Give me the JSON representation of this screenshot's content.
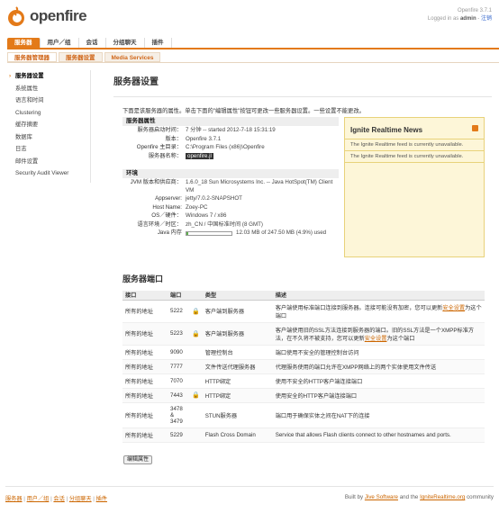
{
  "header": {
    "logo_text": "openfire",
    "version": "Openfire 3.7.1",
    "logged_in_prefix": "Logged in as",
    "user": "admin",
    "logout": "注销"
  },
  "main_tabs": [
    {
      "label": "服务器",
      "active": true
    },
    {
      "label": "用户／组",
      "active": false
    },
    {
      "label": "会话",
      "active": false
    },
    {
      "label": "分组聊天",
      "active": false
    },
    {
      "label": "插件",
      "active": false
    }
  ],
  "sub_tabs": [
    {
      "label": "服务器管理器",
      "active": true
    },
    {
      "label": "服务器设置",
      "active": false
    },
    {
      "label": "Media Services",
      "active": false
    }
  ],
  "sidebar": [
    {
      "label": "服务器设置",
      "active": true
    },
    {
      "label": "系统属性",
      "active": false
    },
    {
      "label": "语言和时间",
      "active": false
    },
    {
      "label": "Clustering",
      "active": false
    },
    {
      "label": "缓存摘要",
      "active": false
    },
    {
      "label": "数据库",
      "active": false
    },
    {
      "label": "日志",
      "active": false
    },
    {
      "label": "邮件设置",
      "active": false
    },
    {
      "label": "Security Audit Viewer",
      "active": false
    }
  ],
  "page": {
    "title": "服务器设置",
    "intro": "下面是该服务器的属性。单击下面的\"编辑属性\"按钮可更改一些服务器设置。一些设置不能更改。"
  },
  "server_props": {
    "header": "服务器属性",
    "rows": [
      {
        "key": "服务器启动时间：",
        "value": "7 分钟 -- started 2012-7-18 15:31:19"
      },
      {
        "key": "版本：",
        "value": "Openfire 3.7.1"
      },
      {
        "key": "Openfire 主目录：",
        "value": "C:\\Program Files (x86)\\Openfire"
      },
      {
        "key": "服务器名称：",
        "value": "openfire.jl"
      }
    ]
  },
  "environment": {
    "header": "环境",
    "rows": [
      {
        "key": "JVM 版本和供应商：",
        "value": "1.6.0_18 Sun Microsystems Inc. -- Java HotSpot(TM) Client VM"
      },
      {
        "key": "Appserver:",
        "value": "jetty/7.0.2-SNAPSHOT"
      },
      {
        "key": "Host Name:",
        "value": "Zoey-PC"
      },
      {
        "key": "OS／硬件：",
        "value": "Windows 7 / x86"
      },
      {
        "key": "语言环境／时区：",
        "value": "zh_CN / 中国标准时间 (8 GMT)"
      }
    ],
    "memory_key": "Java 内存",
    "memory_text": "12.03 MB of 247.50 MB (4.9%) used",
    "memory_fraction": 0.049
  },
  "news": {
    "title": "Ignite Realtime News",
    "items": [
      "The Ignite Realtime feed is currently unavailable.",
      "The Ignite Realtime feed is currently unavailable."
    ]
  },
  "ports": {
    "title": "服务器端口",
    "headers": [
      "接口",
      "端口",
      "",
      "类型",
      "描述"
    ],
    "rows": [
      {
        "iface": "所有的地址",
        "port": "5222",
        "lock": true,
        "type": "客户端到服务器",
        "desc": "客户端使用标准端口连接到服务器。连接可能没有加密，您可以更新",
        "link": "安全设置",
        "desc_after": "为这个端口"
      },
      {
        "iface": "所有的地址",
        "port": "5223",
        "lock": true,
        "type": "客户端到服务器",
        "desc": "客户端使用旧的SSL方法连接到服务器的端口。旧的SSL方法是一个XMPP标准方法，在不久将不被支持，您可以更新",
        "link": "安全设置",
        "desc_after": "为这个端口"
      },
      {
        "iface": "所有的地址",
        "port": "9090",
        "lock": false,
        "type": "管理控制台",
        "desc": "端口使用不安全的管理控制台访问",
        "link": "",
        "desc_after": ""
      },
      {
        "iface": "所有的地址",
        "port": "7777",
        "lock": false,
        "type": "文件传送代理服务器",
        "desc": "代理服务使用的端口允许在XMPP网络上的两个实体使用文件传送",
        "link": "",
        "desc_after": ""
      },
      {
        "iface": "所有的地址",
        "port": "7070",
        "lock": false,
        "type": "HTTP绑定",
        "desc": "使用不安全的HTTP客户端连接端口",
        "link": "",
        "desc_after": ""
      },
      {
        "iface": "所有的地址",
        "port": "7443",
        "lock": true,
        "type": "HTTP绑定",
        "desc": "使用安全的HTTP客户端连接端口",
        "link": "",
        "desc_after": ""
      },
      {
        "iface": "所有的地址",
        "port": "3478 & 3479",
        "lock": false,
        "type": "STUN服务器",
        "desc": "端口用于确保实体之间在NAT下的连接",
        "link": "",
        "desc_after": ""
      },
      {
        "iface": "所有的地址",
        "port": "5229",
        "lock": false,
        "type": "Flash Cross Domain",
        "desc": "Service that allows Flash clients connect to other hostnames and ports.",
        "link": "",
        "desc_after": ""
      }
    ]
  },
  "edit_button": "编辑属性",
  "footer": {
    "links": [
      "服务器",
      "用户／组",
      "会话",
      "分组聊天",
      "插件"
    ],
    "built_by_prefix": "Built by",
    "built_by_link": "Jive Software",
    "and_text": "and the",
    "community_link": "IgniteRealtime.org",
    "community_suffix": "community"
  },
  "colors": {
    "accent": "#e37a19",
    "news_bg": "#fdf6d8"
  }
}
